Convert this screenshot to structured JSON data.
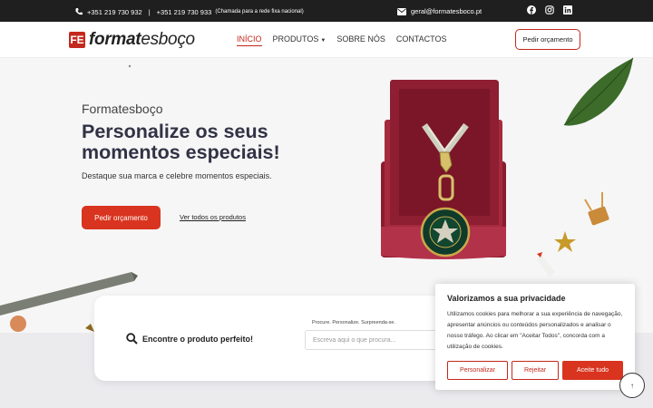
{
  "topbar": {
    "phone1": "+351 219 730 932",
    "separator": "|",
    "phone2": "+351 219 730 933",
    "phone_note": "(Chamada para a rede fixa nacional)",
    "email": "geral@formatesboco.pt",
    "socials": [
      "facebook-icon",
      "instagram-icon",
      "linkedin-icon"
    ]
  },
  "header": {
    "logo_mark": "FE",
    "logo_bold": "format",
    "logo_light": "esboço",
    "nav": [
      "INÍCIO",
      "PRODUTOS",
      "SOBRE NÓS",
      "CONTACTOS"
    ],
    "cta": "Pedir orçamento"
  },
  "hero": {
    "brand": "Formatesboço",
    "title": "Personalize os seus momentos especiais!",
    "subtitle": "Destaque sua marca e celebre momentos especiais.",
    "primary_button": "Pedir orçamento",
    "secondary_link": "Ver todos os produtos"
  },
  "search": {
    "title": "Encontre o produto perfeito!",
    "hint": "Procure. Personalize. Surpreenda-se.",
    "placeholder": "Escreva aqui o que procura..."
  },
  "cookie": {
    "title": "Valorizamos a sua privacidade",
    "text": "Utilizamos cookies para melhorar a sua experiência de navegação, apresentar anúncios ou conteúdos personalizados e analisar o nosso tráfego. Ao clicar em \"Aceitar Todos\", concorda com a utilização de cookies.",
    "customize": "Personalizar",
    "reject": "Rejeitar",
    "accept": "Aceite tudo"
  },
  "colors": {
    "brand_red": "#d8341f",
    "dark": "#1f1f1f",
    "title": "#323246"
  }
}
